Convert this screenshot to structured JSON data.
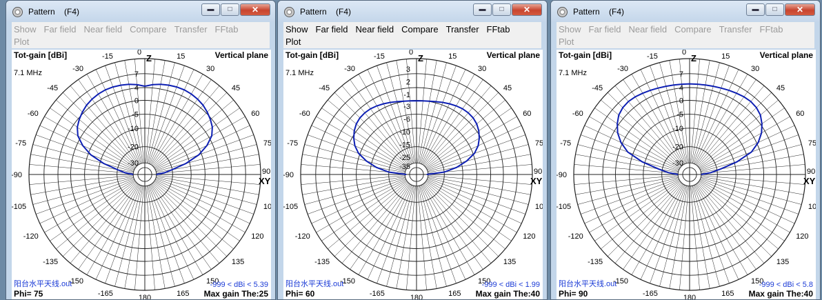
{
  "windows": [
    {
      "id": "w1",
      "title": "Pattern    (F4)",
      "menu_enabled": false,
      "menu": [
        "Show",
        "Far field",
        "Near field",
        "Compare",
        "Transfer",
        "FFtab"
      ],
      "menu2": [
        "Plot"
      ],
      "label_left": "Tot-gain [dBi]",
      "label_right": "Vertical plane",
      "frequency": "7.1 MHz",
      "filename": "阳台水平天线.out",
      "gain_range": "-999 < dBi < 5.39",
      "phi": "Phi= 75",
      "max_gain": "Max gain The:25",
      "radial_labels": [
        "7",
        "4",
        "0",
        "-5",
        "-10",
        "-20",
        "-30"
      ],
      "pattern": [
        [
          -90,
          -30
        ],
        [
          -85,
          -25
        ],
        [
          -80,
          -20
        ],
        [
          -75,
          -12
        ],
        [
          -70,
          -6
        ],
        [
          -65,
          -2
        ],
        [
          -60,
          1
        ],
        [
          -55,
          2.6
        ],
        [
          -50,
          3.6
        ],
        [
          -45,
          4.3
        ],
        [
          -40,
          4.8
        ],
        [
          -35,
          5.1
        ],
        [
          -30,
          5.3
        ],
        [
          -25,
          5.39
        ],
        [
          -20,
          5.35
        ],
        [
          -15,
          5.2
        ],
        [
          -10,
          5.0
        ],
        [
          -5,
          4.7
        ],
        [
          0,
          4.3
        ],
        [
          5,
          4.7
        ],
        [
          10,
          5.0
        ],
        [
          15,
          5.2
        ],
        [
          20,
          5.35
        ],
        [
          25,
          5.39
        ],
        [
          30,
          5.3
        ],
        [
          35,
          5.1
        ],
        [
          40,
          4.8
        ],
        [
          45,
          4.3
        ],
        [
          50,
          3.6
        ],
        [
          55,
          2.6
        ],
        [
          60,
          1
        ],
        [
          65,
          -2
        ],
        [
          70,
          -6
        ],
        [
          75,
          -12
        ],
        [
          80,
          -20
        ],
        [
          85,
          -25
        ],
        [
          90,
          -30
        ]
      ]
    },
    {
      "id": "w2",
      "title": "Pattern    (F4)",
      "menu_enabled": true,
      "menu": [
        "Show",
        "Far field",
        "Near field",
        "Compare",
        "Transfer",
        "FFtab"
      ],
      "menu2": [
        "Plot"
      ],
      "label_left": "Tot-gain [dBi]",
      "label_right": "Vertical plane",
      "frequency": "7.1 MHz",
      "filename": "阳台水平天线.out",
      "gain_range": "-999 < dBi < 1.99",
      "phi": "Phi= 60",
      "max_gain": "Max gain The:40",
      "radial_labels": [
        "3",
        "2",
        "-1",
        "-3",
        "-6",
        "-10",
        "-15",
        "-25",
        "-35"
      ],
      "pattern": [
        [
          -90,
          -33
        ],
        [
          -85,
          -20
        ],
        [
          -80,
          -13
        ],
        [
          -75,
          -8
        ],
        [
          -70,
          -4.5
        ],
        [
          -65,
          -2.2
        ],
        [
          -60,
          -0.6
        ],
        [
          -55,
          0.6
        ],
        [
          -50,
          1.4
        ],
        [
          -45,
          1.85
        ],
        [
          -40,
          1.99
        ],
        [
          -35,
          1.9
        ],
        [
          -30,
          1.6
        ],
        [
          -25,
          1.2
        ],
        [
          -20,
          0.8
        ],
        [
          -15,
          0.4
        ],
        [
          -10,
          0.1
        ],
        [
          -5,
          -0.1
        ],
        [
          0,
          -0.2
        ],
        [
          5,
          -0.1
        ],
        [
          10,
          0.1
        ],
        [
          15,
          0.4
        ],
        [
          20,
          0.8
        ],
        [
          25,
          1.2
        ],
        [
          30,
          1.6
        ],
        [
          35,
          1.9
        ],
        [
          40,
          1.99
        ],
        [
          45,
          1.85
        ],
        [
          50,
          1.4
        ],
        [
          55,
          0.6
        ],
        [
          60,
          -0.6
        ],
        [
          65,
          -2.2
        ],
        [
          70,
          -4.5
        ],
        [
          75,
          -8
        ],
        [
          80,
          -13
        ],
        [
          85,
          -20
        ],
        [
          90,
          -33
        ]
      ]
    },
    {
      "id": "w3",
      "title": "Pattern    (F4)",
      "menu_enabled": false,
      "menu": [
        "Show",
        "Far field",
        "Near field",
        "Compare",
        "Transfer",
        "FFtab"
      ],
      "menu2": [
        "Plot"
      ],
      "label_left": "Tot-gain [dBi]",
      "label_right": "Vertical plane",
      "frequency": "7.1 MHz",
      "filename": "阳台水平天线.out",
      "gain_range": "-999 < dBi < 5.8",
      "phi": "Phi= 90",
      "max_gain": "Max gain The:40",
      "radial_labels": [
        "7",
        "4",
        "0",
        "-5",
        "-10",
        "-20",
        "-30"
      ],
      "pattern": [
        [
          -90,
          -30
        ],
        [
          -85,
          -24
        ],
        [
          -80,
          -18
        ],
        [
          -75,
          -9
        ],
        [
          -70,
          -3
        ],
        [
          -65,
          0.5
        ],
        [
          -60,
          2.8
        ],
        [
          -55,
          4.3
        ],
        [
          -50,
          5.2
        ],
        [
          -45,
          5.65
        ],
        [
          -40,
          5.8
        ],
        [
          -35,
          5.7
        ],
        [
          -30,
          5.5
        ],
        [
          -25,
          5.3
        ],
        [
          -20,
          5.1
        ],
        [
          -15,
          4.95
        ],
        [
          -10,
          4.85
        ],
        [
          -5,
          4.8
        ],
        [
          0,
          4.8
        ],
        [
          5,
          4.8
        ],
        [
          10,
          4.85
        ],
        [
          15,
          4.95
        ],
        [
          20,
          5.1
        ],
        [
          25,
          5.3
        ],
        [
          30,
          5.5
        ],
        [
          35,
          5.7
        ],
        [
          40,
          5.8
        ],
        [
          45,
          5.65
        ],
        [
          50,
          5.2
        ],
        [
          55,
          4.3
        ],
        [
          60,
          2.8
        ],
        [
          65,
          0.5
        ],
        [
          70,
          -3
        ],
        [
          75,
          -9
        ],
        [
          80,
          -18
        ],
        [
          85,
          -24
        ],
        [
          90,
          -30
        ]
      ]
    }
  ],
  "angle_labels": [
    "0",
    "15",
    "30",
    "45",
    "60",
    "75",
    "90",
    "105",
    "120",
    "135",
    "150",
    "165",
    "180",
    "-165",
    "-150",
    "-135",
    "-120",
    "-105",
    "-90",
    "-75",
    "-60",
    "-45",
    "-30",
    "-15"
  ],
  "axis_z": "Z",
  "axis_xy": "XY",
  "colors": {
    "pattern": "#0d1fb3",
    "grid": "#202020",
    "accent": "#1a3ad6"
  }
}
